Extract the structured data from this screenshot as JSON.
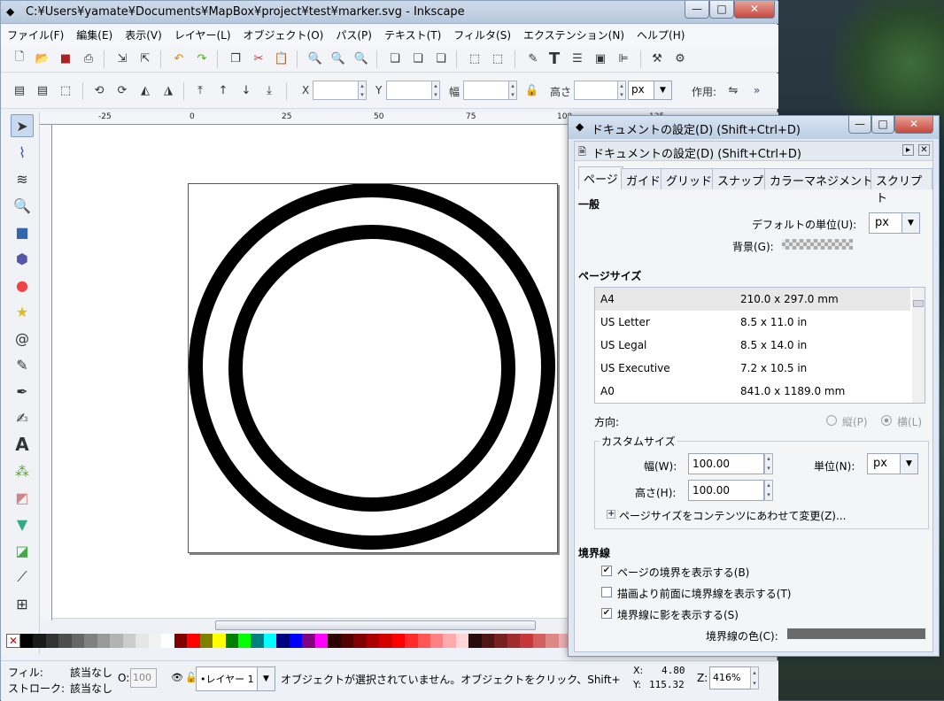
{
  "app": {
    "title": "C:¥Users¥yamate¥Documents¥MapBox¥project¥test¥marker.svg - Inkscape",
    "window_buttons": {
      "min": "—",
      "max": "□",
      "close": "✕"
    }
  },
  "menu": [
    "ファイル(F)",
    "編集(E)",
    "表示(V)",
    "レイヤー(L)",
    "オブジェクト(O)",
    "パス(P)",
    "テキスト(T)",
    "フィルタ(S)",
    "エクステンション(N)",
    "ヘルプ(H)"
  ],
  "controls": {
    "x_label": "X",
    "y_label": "Y",
    "w_label": "幅",
    "h_label": "高さ",
    "unit": "px",
    "action_label": "作用:"
  },
  "ruler": [
    "-25",
    "0",
    "25",
    "50",
    "75",
    "100",
    "125"
  ],
  "dialog": {
    "title": "ドキュメントの設定(D) (Shift+Ctrl+D)",
    "inner_title": "ドキュメントの設定(D) (Shift+Ctrl+D)",
    "tabs": [
      "ページ",
      "ガイド",
      "グリッド",
      "スナップ",
      "カラーマネジメント",
      "スクリプト"
    ],
    "general": "一般",
    "default_unit_label": "デフォルトの単位(U):",
    "default_unit": "px",
    "background_label": "背景(G):",
    "page_size": "ページサイズ",
    "sizes": [
      {
        "name": "A4",
        "size": "210.0 x 297.0 mm"
      },
      {
        "name": "US Letter",
        "size": "8.5 x 11.0 in"
      },
      {
        "name": "US Legal",
        "size": "8.5 x 14.0 in"
      },
      {
        "name": "US Executive",
        "size": "7.2 x 10.5 in"
      },
      {
        "name": "A0",
        "size": "841.0 x 1189.0 mm"
      }
    ],
    "orientation_label": "方向:",
    "portrait": "縦(P)",
    "landscape": "横(L)",
    "custom_size": "カスタムサイズ",
    "width_label": "幅(W):",
    "width": "100.00",
    "height_label": "高さ(H):",
    "height": "100.00",
    "unit_label": "単位(N):",
    "unit": "px",
    "fit_label": "ページサイズをコンテンツにあわせて変更(Z)...",
    "border": "境界線",
    "show_border": "ページの境界を表示する(B)",
    "border_on_top": "描画より前面に境界線を表示する(T)",
    "show_shadow": "境界線に影を表示する(S)",
    "border_color_label": "境界線の色(C):"
  },
  "status": {
    "fill_label": "フィル:",
    "fill_value": "該当なし",
    "stroke_label": "ストローク:",
    "stroke_value": "該当なし",
    "opacity_label": "O:",
    "opacity_value": "100",
    "layer": "•レイヤー 1",
    "message": "オブジェクトが選択されていません。オブジェクトをクリック、Shift+",
    "x_label": "X:",
    "x_value": "4.80",
    "y_label": "Y:",
    "y_value": "115.32",
    "zoom_label": "Z:",
    "zoom_value": "416%"
  },
  "palette": [
    "#000000",
    "#1a1a1a",
    "#333333",
    "#4d4d4d",
    "#666666",
    "#808080",
    "#999999",
    "#b3b3b3",
    "#cccccc",
    "#e6e6e6",
    "#f2f2f2",
    "#ffffff",
    "#800000",
    "#ff0000",
    "#808000",
    "#ffff00",
    "#008000",
    "#00ff00",
    "#008080",
    "#00ffff",
    "#000080",
    "#0000ff",
    "#800080",
    "#ff00ff",
    "#2b0000",
    "#550000",
    "#800000",
    "#aa0000",
    "#d40000",
    "#ff0000",
    "#ff2a2a",
    "#ff5555",
    "#ff8080",
    "#ffaaaa",
    "#ffd5d5",
    "#280b0b",
    "#501616",
    "#782121",
    "#a02c2c",
    "#c83737",
    "#d35f5f",
    "#de8787",
    "#e9afaf"
  ]
}
